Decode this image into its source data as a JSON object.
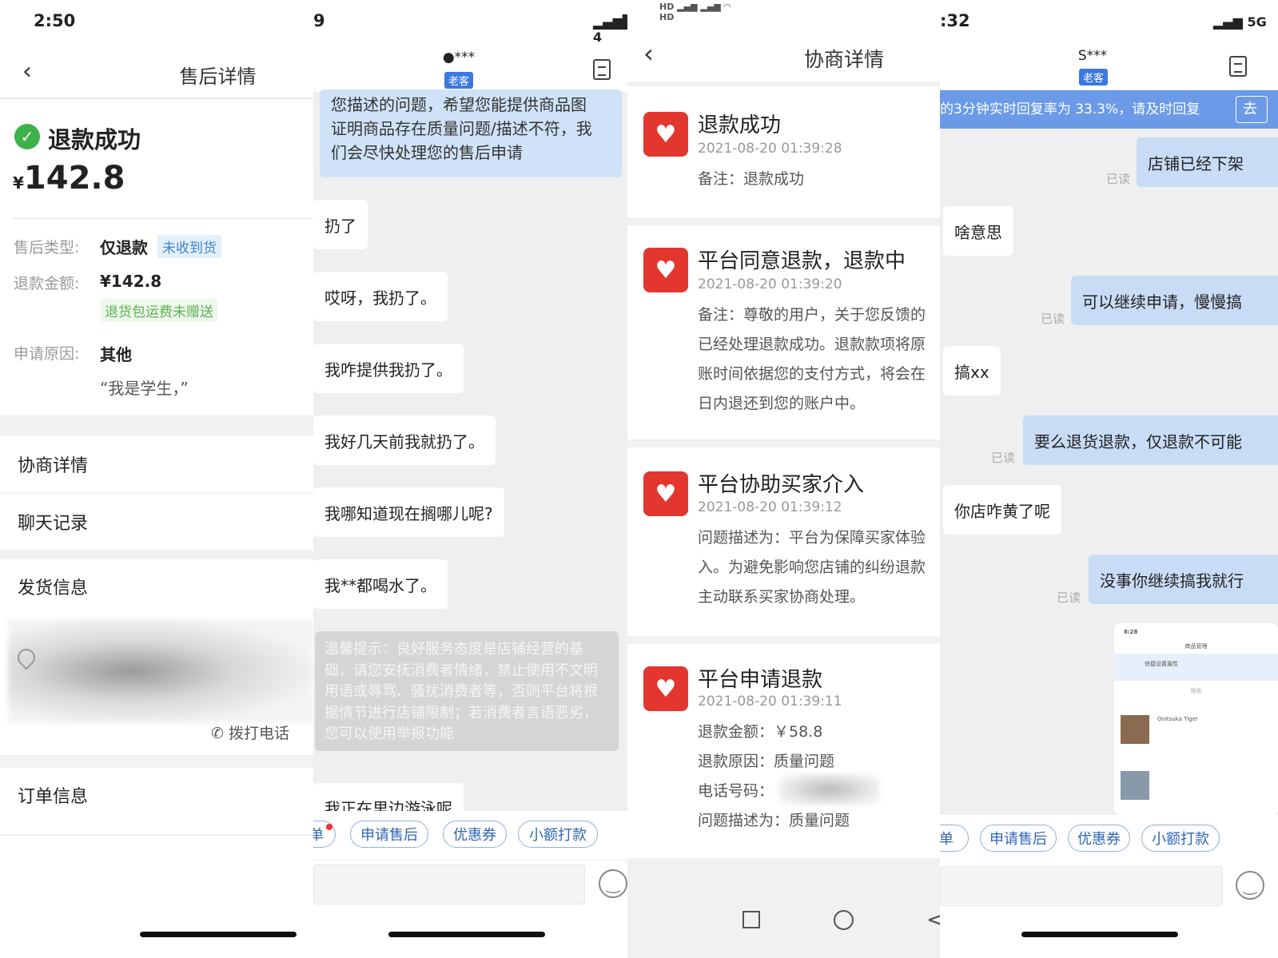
{
  "panel1": {
    "time": "2:50",
    "title": "售后详情",
    "status": "退款成功",
    "amount_currency": "¥",
    "amount": "142.8",
    "fields": [
      {
        "label": "售后类型:",
        "value": "仅退款",
        "tag": "未收到货"
      },
      {
        "label": "退款金额:",
        "value": "¥142.8",
        "tag": "退货包运费未赠送"
      },
      {
        "label": "申请原因:",
        "value": "其他",
        "note": "“我是学生，”"
      }
    ],
    "menu": [
      "协商详情",
      "聊天记录",
      "发货信息",
      "订单信息"
    ],
    "call": "拨打电话"
  },
  "panel2": {
    "time": "9",
    "name": "***",
    "badge": "老客",
    "seller_msg": [
      "您描述的问题，希望您能提供商品图",
      "证明商品存在质量问题/描述不符，我",
      "们会尽快处理您的售后申请"
    ],
    "buyer_msgs": [
      "扔了",
      "哎呀，我扔了。",
      "我咋提供我扔了。",
      "我好几天前我就扔了。",
      "我哪知道现在搁哪儿呢?",
      "我**都喝水了。"
    ],
    "tip": "温馨提示：良好服务态度是店铺经营的基础，请您安抚消费者情绪，禁止使用不文明用语或辱骂、骚扰消费者等，否则平台将根据情节进行店铺限制；若消费者言语恶劣，您可以使用举报功能",
    "partial_msg": "我正在里边游泳呢",
    "chips": [
      "单",
      "申请售后",
      "优惠券",
      "小额打款"
    ]
  },
  "panel3": {
    "title": "协商详情",
    "cards": [
      {
        "title": "退款成功",
        "time": "2021-08-20 01:39:28",
        "lines": [
          "备注：退款成功"
        ]
      },
      {
        "title": "平台同意退款，退款中",
        "time": "2021-08-20 01:39:20",
        "lines": [
          "备注：尊敬的用户，关于您反馈的",
          "已经处理退款成功。退款款项将原",
          "账时间依据您的支付方式，将会在",
          "日内退还到您的账户中。"
        ]
      },
      {
        "title": "平台协助买家介入",
        "time": "2021-08-20 01:39:12",
        "lines": [
          "问题描述为：平台为保障买家体验",
          "入。为避免影响您店铺的纠纷退款",
          "主动联系买家协商处理。"
        ]
      },
      {
        "title": "平台申请退款",
        "time": "2021-08-20 01:39:11",
        "lines": [
          "退款金额：￥58.8",
          "退款原因：质量问题",
          "电话号码：",
          "问题描述为：质量问题"
        ]
      }
    ]
  },
  "panel4": {
    "time": ":32",
    "network": "5G",
    "name": "S***",
    "badge": "老客",
    "banner": "的3分钟实时回复率为 33.3%，请及时回复",
    "banner_btn": "去",
    "messages": [
      {
        "side": "me",
        "text": "店铺已经下架",
        "read": "已读"
      },
      {
        "side": "other",
        "text": "啥意思"
      },
      {
        "side": "me",
        "text": "可以继续申请，慢慢搞",
        "read": "已读"
      },
      {
        "side": "other",
        "text": "搞xx"
      },
      {
        "side": "me",
        "text": "要么退货退款，仅退款不可能",
        "read": "已读"
      },
      {
        "side": "other",
        "text": "你店咋黄了呢"
      },
      {
        "side": "me",
        "text": "没事你继续搞我就行",
        "read": "已读"
      }
    ],
    "screenshot": {
      "time": "8:28",
      "title": "商品管理",
      "banner": "快捷设置属性",
      "search": "搜索",
      "product": "Onitsuka Tiger"
    },
    "chips": [
      "单",
      "申请售后",
      "优惠券",
      "小额打款"
    ]
  }
}
